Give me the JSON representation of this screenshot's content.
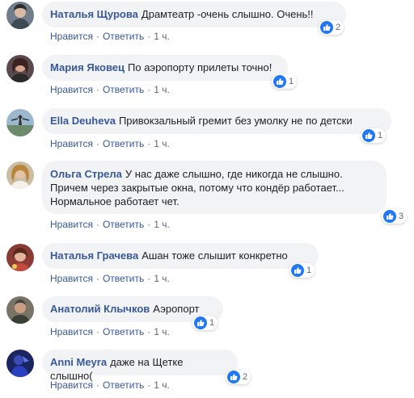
{
  "actions": {
    "like": "Нравится",
    "reply": "Ответить",
    "separator": "·"
  },
  "colors": {
    "author": "#385898",
    "bubble": "#f2f3f5",
    "like_badge": "#2078f4"
  },
  "comments": [
    {
      "author": "Наталья Щурова",
      "text": "Драмтеатр -очень слышно. Очень!!",
      "time": "1 ч.",
      "likes": "2"
    },
    {
      "author": "Мария Яковец",
      "text": "По аэропорту прилеты точно!",
      "time": "1 ч.",
      "likes": "1"
    },
    {
      "author": "Ella Deuheva",
      "text": "Привокзальный гремит без умолку не по детски",
      "time": "1 ч.",
      "likes": "1"
    },
    {
      "author": "Ольга Стрела",
      "text": "У нас даже слышно, где никогда не слышно. Причем через закрытые окна, потому что кондёр работает... Нормальное работает чет.",
      "time": "1 ч.",
      "likes": "3"
    },
    {
      "author": "Наталья Грачева",
      "text": "Ашан тоже слышит конкретно",
      "time": "1 ч.",
      "likes": "1"
    },
    {
      "author": "Анатолий Клычков",
      "text": "Аэропорт",
      "time": "1 ч.",
      "likes": "1"
    },
    {
      "author": "Anni Meyra",
      "text": "даже на Щетке слышно(",
      "time": "1 ч.",
      "likes": "2"
    }
  ]
}
